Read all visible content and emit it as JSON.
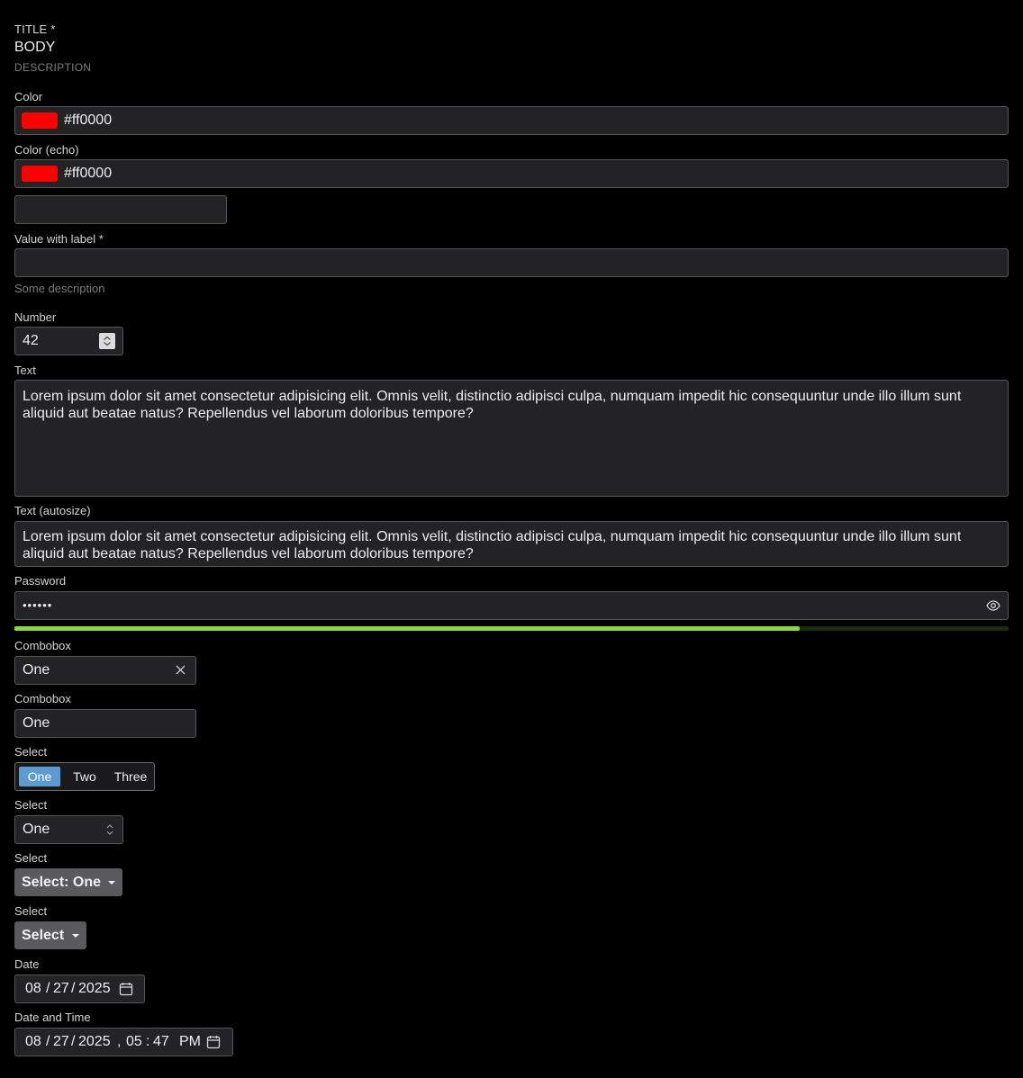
{
  "header": {
    "title": "TITLE *",
    "body": "BODY",
    "description": "DESCRIPTION"
  },
  "color": {
    "label": "Color",
    "value": "#ff0000",
    "swatch": "#ff0000"
  },
  "color_echo": {
    "label": "Color (echo)",
    "value": "#ff0000",
    "swatch": "#ff0000"
  },
  "value_label": {
    "label": "Value with label *",
    "description": "Some description"
  },
  "number": {
    "label": "Number",
    "value": "42"
  },
  "text": {
    "label": "Text",
    "value": "Lorem ipsum dolor sit amet consectetur adipisicing elit. Omnis velit, distinctio adipisci culpa, numquam impedit hic consequuntur unde illo illum sunt aliquid aut beatae natus? Repellendus vel laborum doloribus tempore?"
  },
  "text_autosize": {
    "label": "Text (autosize)",
    "value": "Lorem ipsum dolor sit amet consectetur adipisicing elit. Omnis velit, distinctio adipisci culpa, numquam impedit hic consequuntur unde illo illum sunt aliquid aut beatae natus? Repellendus vel laborum doloribus tempore?"
  },
  "password": {
    "label": "Password",
    "masked": "••••••",
    "strength_percent": 79,
    "strength_color": "#8fd63d"
  },
  "combobox1": {
    "label": "Combobox",
    "value": "One"
  },
  "combobox2": {
    "label": "Combobox",
    "value": "One"
  },
  "select_segmented": {
    "label": "Select",
    "options": [
      "One",
      "Two",
      "Three"
    ],
    "selected": "One",
    "accent": "#5d9bd1"
  },
  "select_native": {
    "label": "Select",
    "value": "One"
  },
  "select_menu1": {
    "label": "Select",
    "button": "Select: One"
  },
  "select_menu2": {
    "label": "Select",
    "button": "Select"
  },
  "date": {
    "label": "Date",
    "month": "08",
    "day": "27",
    "year": "2025"
  },
  "datetime": {
    "label": "Date and Time",
    "month": "08",
    "day": "27",
    "year": "2025",
    "hour": "05",
    "minute": "47",
    "ampm": "PM"
  },
  "icons": {
    "visibility": "eye-icon",
    "clear": "close-icon",
    "calendar": "calendar-icon",
    "spinner": "up-down-icon",
    "dropdown": "caret-down-icon"
  }
}
